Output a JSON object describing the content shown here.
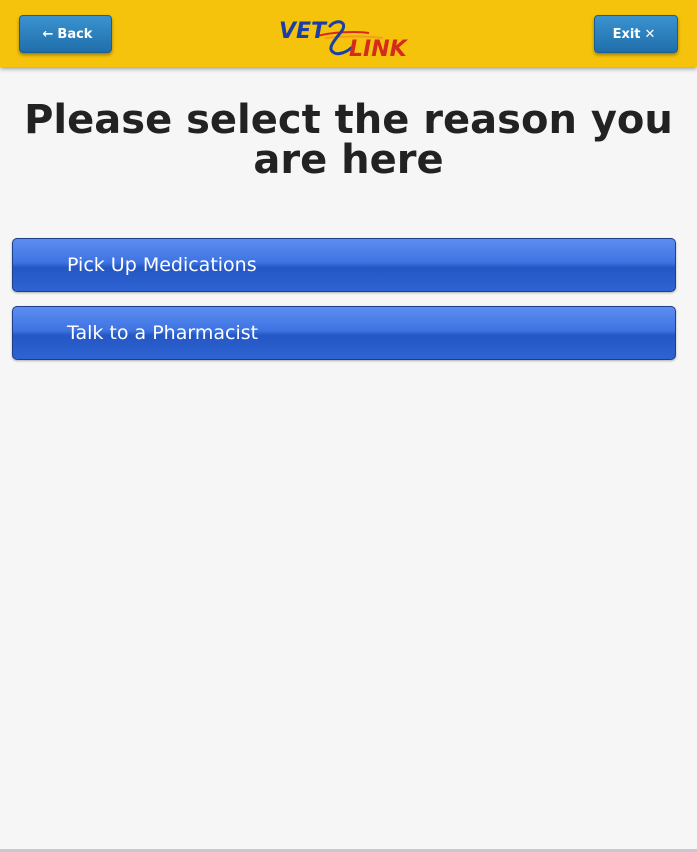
{
  "header": {
    "back_label": "Back",
    "back_icon": "arrow-left-icon",
    "exit_label": "Exit",
    "exit_icon": "close-icon",
    "logo": {
      "part1": "VET",
      "part2": "LINK"
    }
  },
  "main": {
    "title": "Please select the reason you are here",
    "options": [
      {
        "label": "Pick Up Medications"
      },
      {
        "label": "Talk to a Pharmacist"
      }
    ]
  },
  "colors": {
    "header_bg": "#f5c30b",
    "header_button": "#2a82c0",
    "option_button": "#3a6fe0",
    "logo_blue": "#1b3fa6",
    "logo_red": "#d52b1e"
  }
}
